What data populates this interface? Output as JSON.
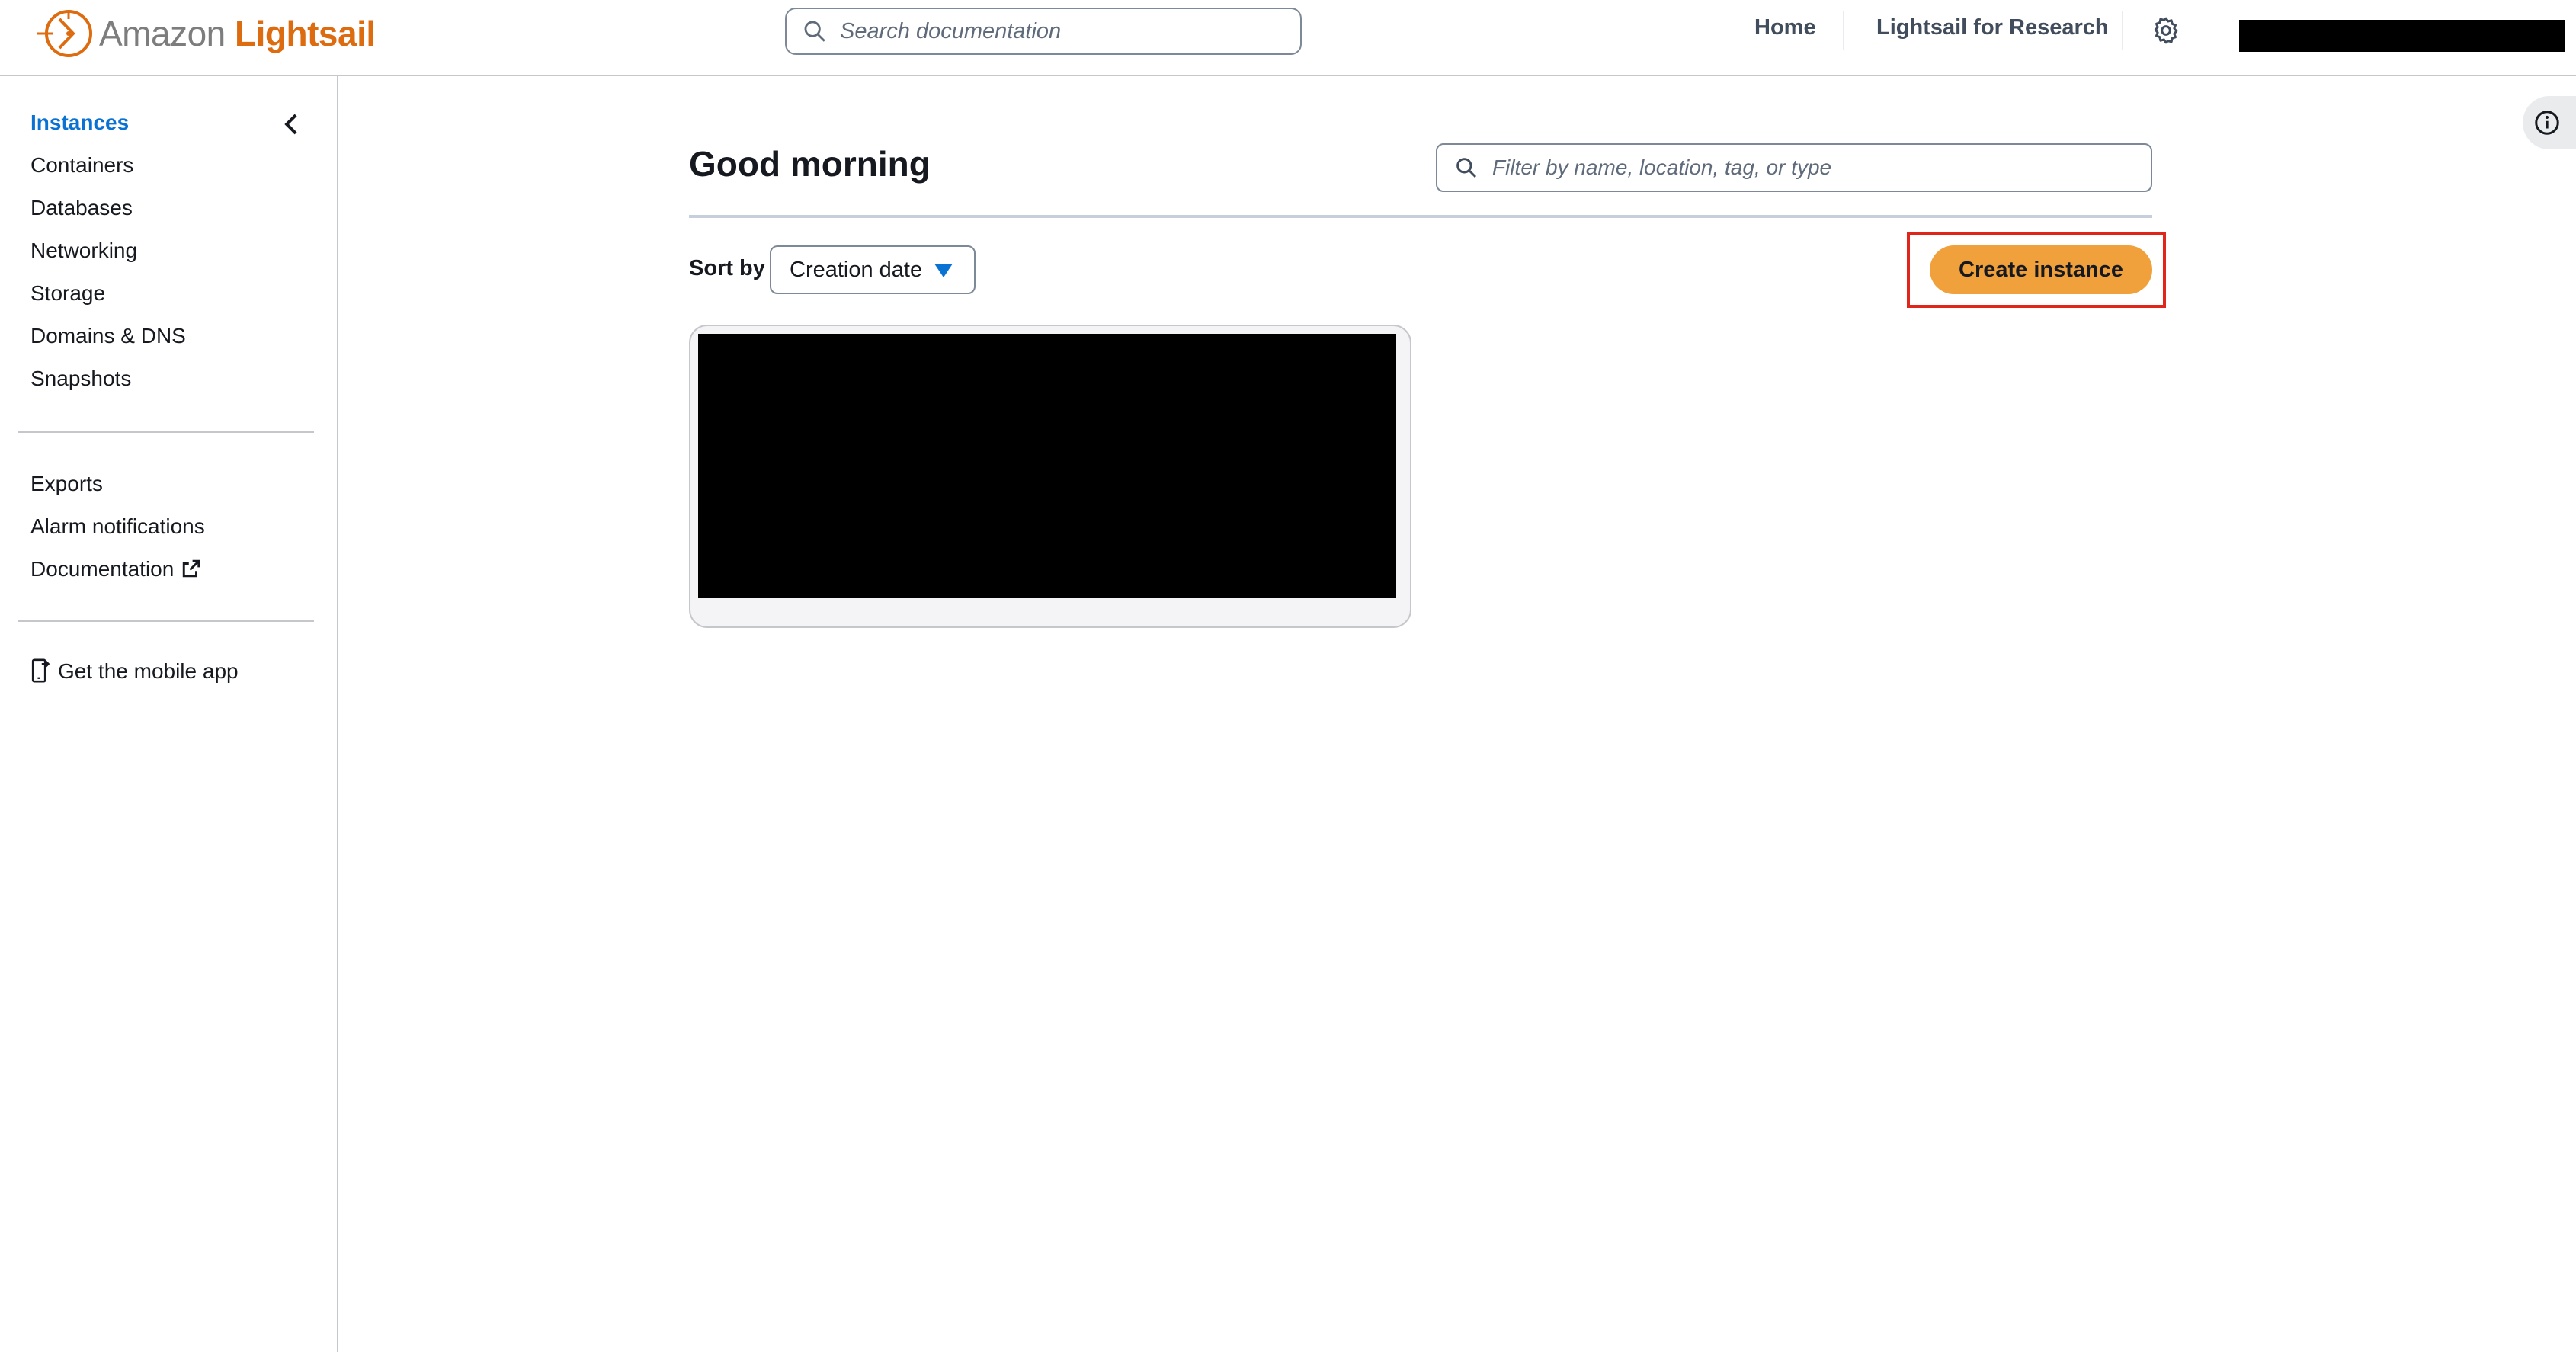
{
  "header": {
    "logo_amazon": "Amazon",
    "logo_lightsail": "Lightsail",
    "search_placeholder": "Search documentation",
    "nav": {
      "home": "Home",
      "research": "Lightsail for Research"
    }
  },
  "sidebar": {
    "primary": [
      {
        "label": "Instances",
        "active": true
      },
      {
        "label": "Containers"
      },
      {
        "label": "Databases"
      },
      {
        "label": "Networking"
      },
      {
        "label": "Storage"
      },
      {
        "label": "Domains & DNS"
      },
      {
        "label": "Snapshots"
      }
    ],
    "secondary": [
      {
        "label": "Exports"
      },
      {
        "label": "Alarm notifications"
      },
      {
        "label": "Documentation"
      }
    ],
    "mobile_app": "Get the mobile app"
  },
  "main": {
    "greeting": "Good morning",
    "filter_placeholder": "Filter by name, location, tag, or type",
    "sort_label": "Sort by",
    "sort_value": "Creation date",
    "create_button": "Create instance"
  },
  "colors": {
    "accent_link": "#0972d3",
    "brand_orange": "#dd6b10",
    "primary_button": "#f0a13b",
    "highlight_box": "#e0261b"
  }
}
